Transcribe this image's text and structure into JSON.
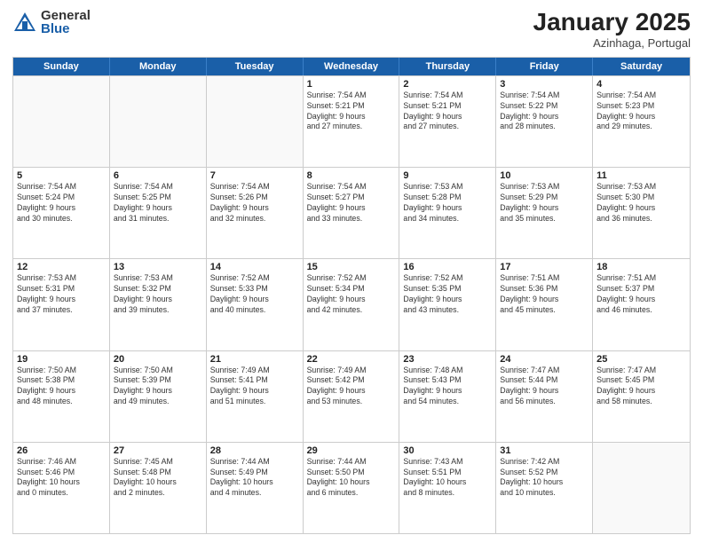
{
  "header": {
    "logo_general": "General",
    "logo_blue": "Blue",
    "month_title": "January 2025",
    "subtitle": "Azinhaga, Portugal"
  },
  "weekdays": [
    "Sunday",
    "Monday",
    "Tuesday",
    "Wednesday",
    "Thursday",
    "Friday",
    "Saturday"
  ],
  "weeks": [
    [
      {
        "day": "",
        "info": ""
      },
      {
        "day": "",
        "info": ""
      },
      {
        "day": "",
        "info": ""
      },
      {
        "day": "1",
        "info": "Sunrise: 7:54 AM\nSunset: 5:21 PM\nDaylight: 9 hours\nand 27 minutes."
      },
      {
        "day": "2",
        "info": "Sunrise: 7:54 AM\nSunset: 5:21 PM\nDaylight: 9 hours\nand 27 minutes."
      },
      {
        "day": "3",
        "info": "Sunrise: 7:54 AM\nSunset: 5:22 PM\nDaylight: 9 hours\nand 28 minutes."
      },
      {
        "day": "4",
        "info": "Sunrise: 7:54 AM\nSunset: 5:23 PM\nDaylight: 9 hours\nand 29 minutes."
      }
    ],
    [
      {
        "day": "5",
        "info": "Sunrise: 7:54 AM\nSunset: 5:24 PM\nDaylight: 9 hours\nand 30 minutes."
      },
      {
        "day": "6",
        "info": "Sunrise: 7:54 AM\nSunset: 5:25 PM\nDaylight: 9 hours\nand 31 minutes."
      },
      {
        "day": "7",
        "info": "Sunrise: 7:54 AM\nSunset: 5:26 PM\nDaylight: 9 hours\nand 32 minutes."
      },
      {
        "day": "8",
        "info": "Sunrise: 7:54 AM\nSunset: 5:27 PM\nDaylight: 9 hours\nand 33 minutes."
      },
      {
        "day": "9",
        "info": "Sunrise: 7:53 AM\nSunset: 5:28 PM\nDaylight: 9 hours\nand 34 minutes."
      },
      {
        "day": "10",
        "info": "Sunrise: 7:53 AM\nSunset: 5:29 PM\nDaylight: 9 hours\nand 35 minutes."
      },
      {
        "day": "11",
        "info": "Sunrise: 7:53 AM\nSunset: 5:30 PM\nDaylight: 9 hours\nand 36 minutes."
      }
    ],
    [
      {
        "day": "12",
        "info": "Sunrise: 7:53 AM\nSunset: 5:31 PM\nDaylight: 9 hours\nand 37 minutes."
      },
      {
        "day": "13",
        "info": "Sunrise: 7:53 AM\nSunset: 5:32 PM\nDaylight: 9 hours\nand 39 minutes."
      },
      {
        "day": "14",
        "info": "Sunrise: 7:52 AM\nSunset: 5:33 PM\nDaylight: 9 hours\nand 40 minutes."
      },
      {
        "day": "15",
        "info": "Sunrise: 7:52 AM\nSunset: 5:34 PM\nDaylight: 9 hours\nand 42 minutes."
      },
      {
        "day": "16",
        "info": "Sunrise: 7:52 AM\nSunset: 5:35 PM\nDaylight: 9 hours\nand 43 minutes."
      },
      {
        "day": "17",
        "info": "Sunrise: 7:51 AM\nSunset: 5:36 PM\nDaylight: 9 hours\nand 45 minutes."
      },
      {
        "day": "18",
        "info": "Sunrise: 7:51 AM\nSunset: 5:37 PM\nDaylight: 9 hours\nand 46 minutes."
      }
    ],
    [
      {
        "day": "19",
        "info": "Sunrise: 7:50 AM\nSunset: 5:38 PM\nDaylight: 9 hours\nand 48 minutes."
      },
      {
        "day": "20",
        "info": "Sunrise: 7:50 AM\nSunset: 5:39 PM\nDaylight: 9 hours\nand 49 minutes."
      },
      {
        "day": "21",
        "info": "Sunrise: 7:49 AM\nSunset: 5:41 PM\nDaylight: 9 hours\nand 51 minutes."
      },
      {
        "day": "22",
        "info": "Sunrise: 7:49 AM\nSunset: 5:42 PM\nDaylight: 9 hours\nand 53 minutes."
      },
      {
        "day": "23",
        "info": "Sunrise: 7:48 AM\nSunset: 5:43 PM\nDaylight: 9 hours\nand 54 minutes."
      },
      {
        "day": "24",
        "info": "Sunrise: 7:47 AM\nSunset: 5:44 PM\nDaylight: 9 hours\nand 56 minutes."
      },
      {
        "day": "25",
        "info": "Sunrise: 7:47 AM\nSunset: 5:45 PM\nDaylight: 9 hours\nand 58 minutes."
      }
    ],
    [
      {
        "day": "26",
        "info": "Sunrise: 7:46 AM\nSunset: 5:46 PM\nDaylight: 10 hours\nand 0 minutes."
      },
      {
        "day": "27",
        "info": "Sunrise: 7:45 AM\nSunset: 5:48 PM\nDaylight: 10 hours\nand 2 minutes."
      },
      {
        "day": "28",
        "info": "Sunrise: 7:44 AM\nSunset: 5:49 PM\nDaylight: 10 hours\nand 4 minutes."
      },
      {
        "day": "29",
        "info": "Sunrise: 7:44 AM\nSunset: 5:50 PM\nDaylight: 10 hours\nand 6 minutes."
      },
      {
        "day": "30",
        "info": "Sunrise: 7:43 AM\nSunset: 5:51 PM\nDaylight: 10 hours\nand 8 minutes."
      },
      {
        "day": "31",
        "info": "Sunrise: 7:42 AM\nSunset: 5:52 PM\nDaylight: 10 hours\nand 10 minutes."
      },
      {
        "day": "",
        "info": ""
      }
    ]
  ]
}
